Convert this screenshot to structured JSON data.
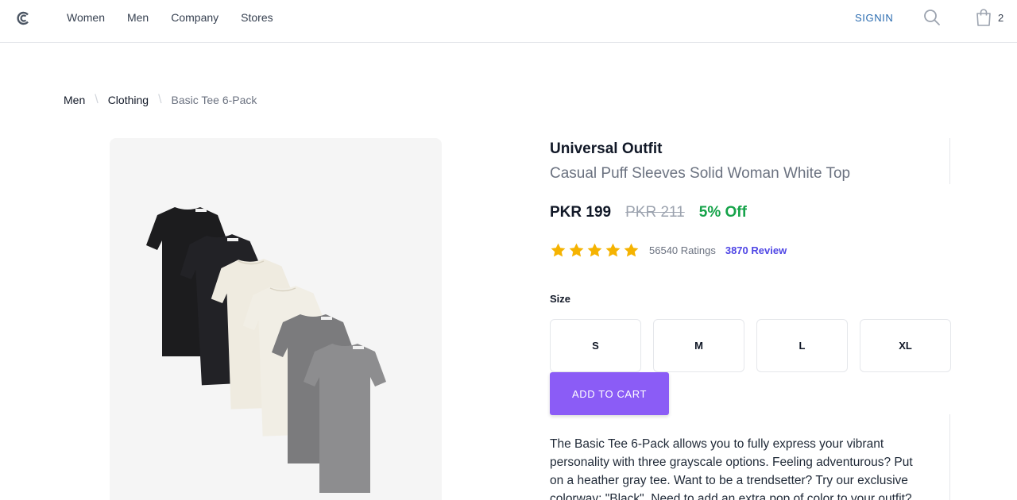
{
  "header": {
    "nav": [
      "Women",
      "Men",
      "Company",
      "Stores"
    ],
    "signin_label": "SIGNIN",
    "cart_count": "2"
  },
  "breadcrumb": {
    "items": [
      "Men",
      "Clothing"
    ],
    "current": "Basic Tee 6-Pack"
  },
  "product": {
    "brand": "Universal Outfit",
    "title": "Casual Puff Sleeves Solid Woman White Top",
    "price": "PKR 199",
    "old_price": "PKR 211",
    "discount": "5% Off",
    "rating_stars": 5,
    "ratings_count": "56540 Ratings",
    "reviews_label": "3870 Review",
    "size_label": "Size",
    "sizes": [
      "S",
      "M",
      "L",
      "XL"
    ],
    "add_to_cart_label": "ADD TO CART",
    "description": "The Basic Tee 6-Pack allows you to fully express your vibrant personality with three grayscale options. Feeling adventurous? Put on a heather gray tee. Want to be a trendsetter? Try our exclusive colorway: \"Black\". Need to add an extra pop of color to your outfit?"
  },
  "colors": {
    "accent": "#8b5cf6",
    "link": "#2b6cb0",
    "discount": "#16a34a",
    "star": "#f5b301",
    "review_link": "#4f46e5"
  },
  "icons": {
    "logo": "brand-logo-icon",
    "search": "search-icon",
    "cart": "shopping-bag-icon",
    "star": "star-icon"
  }
}
